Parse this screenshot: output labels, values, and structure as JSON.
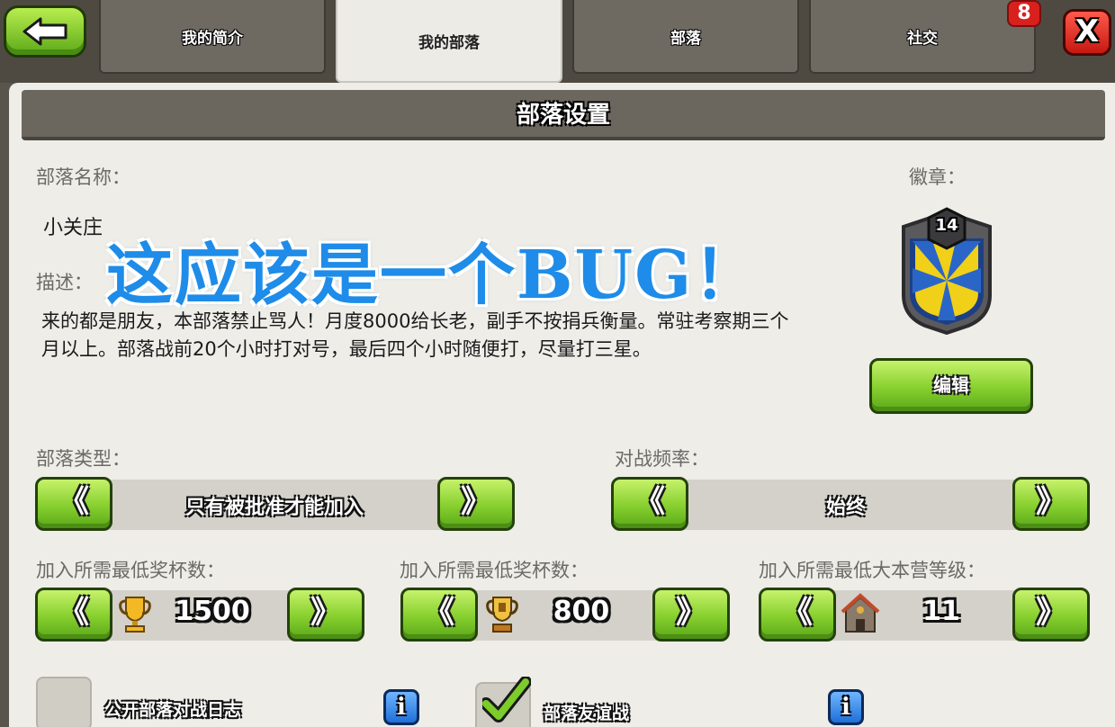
{
  "tabs": [
    "我的简介",
    "我的部落",
    "部落",
    "社交"
  ],
  "notification_count": "8",
  "close_label": "X",
  "section_title": "部落设置",
  "clan_name_label": "部落名称：",
  "clan_name": "小关庄",
  "badge_label": "徽章：",
  "badge_level": "14",
  "description_label": "描述：",
  "description": "来的都是朋友，本部落禁止骂人！月度8000给长老，副手不按捐兵衡量。常驻考察期三个月以上。部落战前20个小时打对号，最后四个小时随便打，尽量打三星。",
  "overlay_text": "这应该是一个BUG！",
  "edit_button": "编辑",
  "clan_type_label": "部落类型：",
  "clan_type_value": "只有被批准才能加入",
  "war_frequency_label": "对战频率：",
  "war_frequency_value": "始终",
  "arrow_left": "《",
  "arrow_right": "》",
  "min_trophies_label": "加入所需最低奖杯数：",
  "min_trophies_value": "1500",
  "min_builder_trophies_label": "加入所需最低奖杯数：",
  "min_builder_trophies_value": "800",
  "min_th_label": "加入所需最低大本营等级：",
  "min_th_value": "11",
  "public_war_log_label": "公开部落对战日志",
  "info_label": "i",
  "friendly_war_label": "部落友谊战",
  "colors": {
    "green": "#86cf2e",
    "panel": "#eeede8",
    "header": "#6c675e",
    "overlay": "#1e8ce8"
  }
}
